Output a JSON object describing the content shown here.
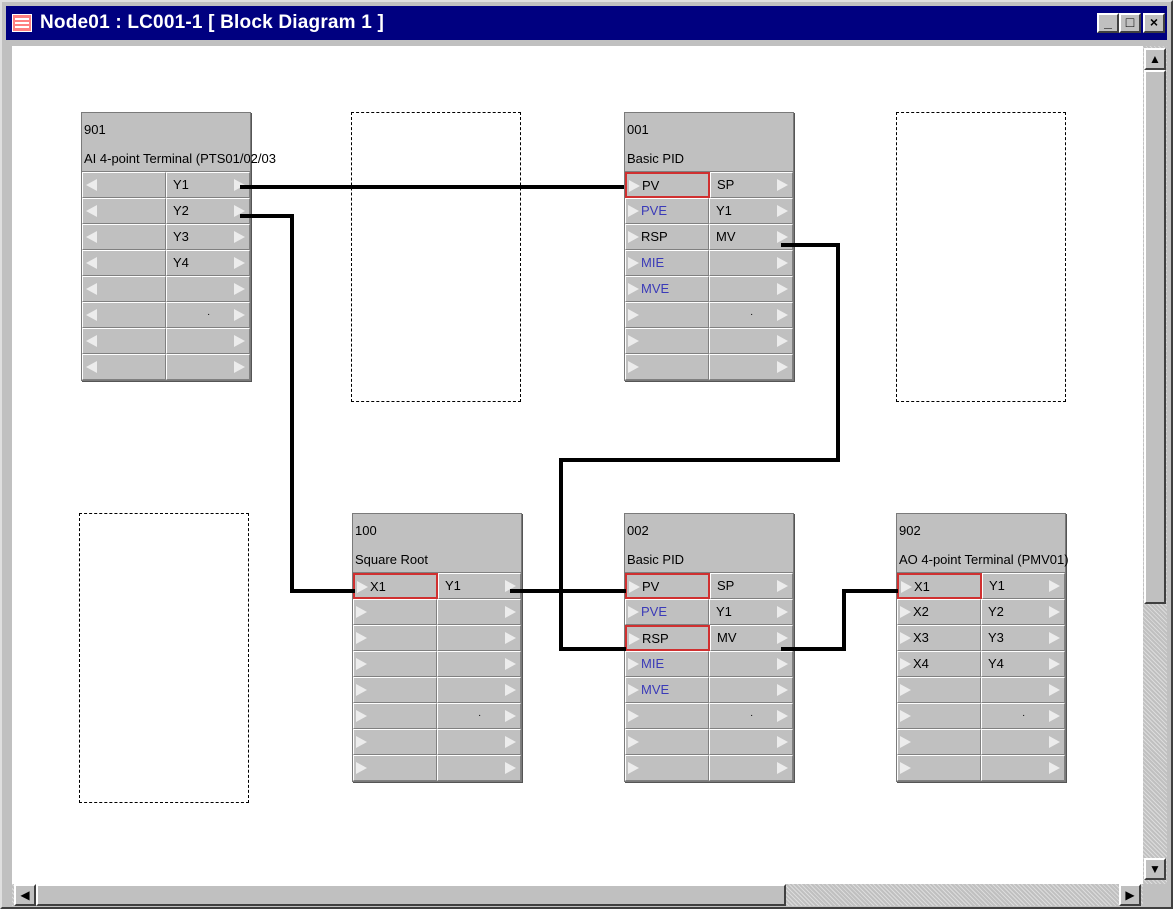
{
  "window": {
    "title": "Node01 : LC001-1 [ Block Diagram 1 ]",
    "controls": {
      "minimize": "_",
      "maximize": "□",
      "close": "×"
    }
  },
  "blocks": {
    "b901": {
      "number": "901",
      "name": "AI 4-point Terminal (PTS01/02/03",
      "inputs": [],
      "outputs": [
        "Y1",
        "Y2",
        "Y3",
        "Y4",
        "",
        "",
        "",
        ""
      ]
    },
    "b001": {
      "number": "001",
      "name": "Basic PID",
      "inputs": [
        "PV",
        "PVE",
        "RSP",
        "MIE",
        "MVE",
        "",
        "",
        ""
      ],
      "outputs": [
        "SP",
        "Y1",
        "MV",
        "",
        "",
        "",
        "",
        ""
      ]
    },
    "b100": {
      "number": "100",
      "name": "Square Root",
      "inputs": [
        "X1",
        "",
        "",
        "",
        "",
        "",
        "",
        ""
      ],
      "outputs": [
        "Y1",
        "",
        "",
        "",
        "",
        "",
        "",
        ""
      ]
    },
    "b002": {
      "number": "002",
      "name": "Basic PID",
      "inputs": [
        "PV",
        "PVE",
        "RSP",
        "MIE",
        "MVE",
        "",
        "",
        ""
      ],
      "outputs": [
        "SP",
        "Y1",
        "MV",
        "",
        "",
        "",
        "",
        ""
      ]
    },
    "b902": {
      "number": "902",
      "name": "AO 4-point Terminal (PMV01)",
      "inputs": [
        "X1",
        "X2",
        "X3",
        "X4",
        "",
        "",
        "",
        ""
      ],
      "outputs": [
        "Y1",
        "Y2",
        "Y3",
        "Y4",
        "",
        "",
        "",
        ""
      ]
    }
  },
  "colors": {
    "titlebar": "#000080",
    "selected_terminal": "#d03030",
    "disabled_label": "#3a3ab8",
    "wire": "#000000"
  },
  "icons": {
    "input_terminal": "triangle-right-icon",
    "output_terminal": "triangle-right-icon",
    "ai_input": "triangle-left-icon"
  }
}
